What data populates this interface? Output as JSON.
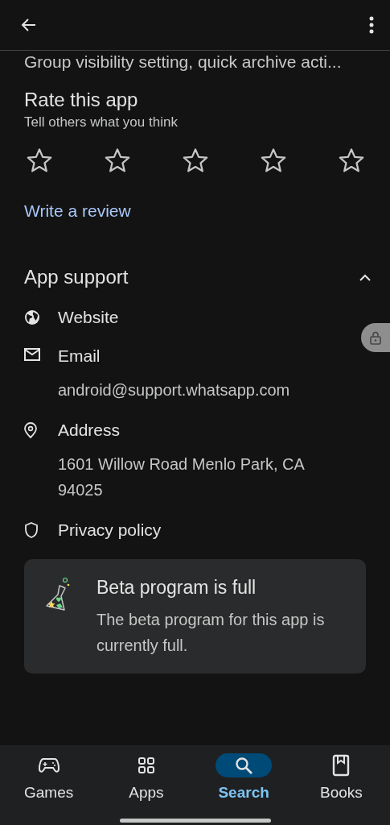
{
  "header": {
    "prev_text": "Group visibility setting, quick archive acti..."
  },
  "rating": {
    "title": "Rate this app",
    "subtitle": "Tell others what you think",
    "stars": 0,
    "link": "Write a review"
  },
  "app_support": {
    "title": "App support",
    "expanded": true,
    "items": [
      {
        "kind": "website",
        "label": "Website"
      },
      {
        "kind": "email",
        "label": "Email",
        "detail": "android@support.whatsapp.com"
      },
      {
        "kind": "address",
        "label": "Address",
        "detail": "1601 Willow Road Menlo Park, CA 94025"
      },
      {
        "kind": "privacy",
        "label": "Privacy policy"
      }
    ]
  },
  "beta": {
    "title": "Beta program is full",
    "text": "The beta program for this app is currently full."
  },
  "bottom_nav": [
    {
      "kind": "games",
      "label": "Games",
      "selected": false
    },
    {
      "kind": "apps",
      "label": "Apps",
      "selected": false
    },
    {
      "kind": "search",
      "label": "Search",
      "selected": true
    },
    {
      "kind": "books",
      "label": "Books",
      "selected": false
    }
  ]
}
